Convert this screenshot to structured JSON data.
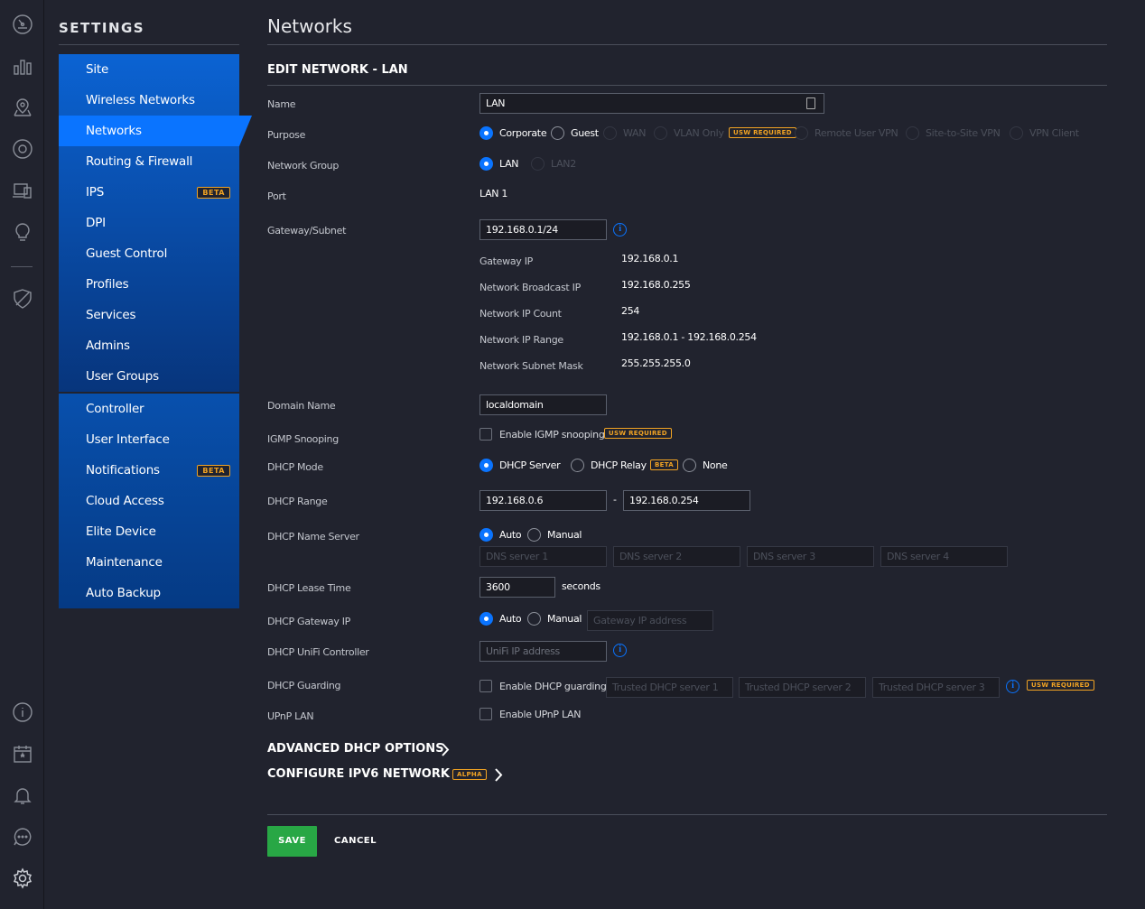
{
  "settings": {
    "title": "SETTINGS",
    "menu_top": [
      {
        "label": "Site"
      },
      {
        "label": "Wireless Networks"
      },
      {
        "label": "Networks"
      },
      {
        "label": "Routing & Firewall"
      },
      {
        "label": "IPS",
        "badge": "BETA"
      },
      {
        "label": "DPI"
      },
      {
        "label": "Guest Control"
      },
      {
        "label": "Profiles"
      },
      {
        "label": "Services"
      },
      {
        "label": "Admins"
      },
      {
        "label": "User Groups"
      }
    ],
    "menu_bottom": [
      {
        "label": "Controller"
      },
      {
        "label": "User Interface"
      },
      {
        "label": "Notifications",
        "badge": "BETA"
      },
      {
        "label": "Cloud Access"
      },
      {
        "label": "Elite Device"
      },
      {
        "label": "Maintenance"
      },
      {
        "label": "Auto Backup"
      }
    ]
  },
  "page": {
    "title": "Networks",
    "section": "EDIT NETWORK - LAN"
  },
  "form": {
    "name": {
      "label": "Name",
      "value": "LAN"
    },
    "purpose": {
      "label": "Purpose",
      "options": [
        "Corporate",
        "Guest",
        "WAN",
        "VLAN Only",
        "Remote User VPN",
        "Site-to-Site VPN",
        "VPN Client"
      ],
      "selected": "Corporate",
      "vlan_tag": "USW REQUIRED"
    },
    "network_group": {
      "label": "Network Group",
      "options": [
        "LAN",
        "LAN2"
      ],
      "selected": "LAN"
    },
    "port": {
      "label": "Port",
      "value": "LAN 1"
    },
    "gateway_subnet": {
      "label": "Gateway/Subnet",
      "value": "192.168.0.1/24"
    },
    "subnet_info": [
      {
        "label": "Gateway IP",
        "value": "192.168.0.1"
      },
      {
        "label": "Network Broadcast IP",
        "value": "192.168.0.255"
      },
      {
        "label": "Network IP Count",
        "value": "254"
      },
      {
        "label": "Network IP Range",
        "value": "192.168.0.1 - 192.168.0.254"
      },
      {
        "label": "Network Subnet Mask",
        "value": "255.255.255.0"
      }
    ],
    "domain_name": {
      "label": "Domain Name",
      "value": "localdomain"
    },
    "igmp": {
      "label": "IGMP Snooping",
      "checkbox": "Enable IGMP snooping",
      "tag": "USW REQUIRED"
    },
    "dhcp_mode": {
      "label": "DHCP Mode",
      "options": [
        "DHCP Server",
        "DHCP Relay",
        "None"
      ],
      "selected": "DHCP Server",
      "relay_tag": "BETA"
    },
    "dhcp_range": {
      "label": "DHCP Range",
      "start": "192.168.0.6",
      "separator": "-",
      "end": "192.168.0.254"
    },
    "dhcp_name_server": {
      "label": "DHCP Name Server",
      "options": [
        "Auto",
        "Manual"
      ],
      "selected": "Auto",
      "placeholders": [
        "DNS server 1",
        "DNS server 2",
        "DNS server 3",
        "DNS server 4"
      ]
    },
    "dhcp_lease": {
      "label": "DHCP Lease Time",
      "value": "3600",
      "unit": "seconds"
    },
    "dhcp_gateway": {
      "label": "DHCP Gateway IP",
      "options": [
        "Auto",
        "Manual"
      ],
      "selected": "Auto",
      "placeholder": "Gateway IP address"
    },
    "dhcp_unifi": {
      "label": "DHCP UniFi Controller",
      "placeholder": "UniFi IP address"
    },
    "dhcp_guarding": {
      "label": "DHCP Guarding",
      "checkbox": "Enable DHCP guarding",
      "placeholders": [
        "Trusted DHCP server 1",
        "Trusted DHCP server 2",
        "Trusted DHCP server 3"
      ],
      "tag": "USW REQUIRED"
    },
    "upnp": {
      "label": "UPnP LAN",
      "checkbox": "Enable UPnP LAN"
    }
  },
  "expanders": {
    "advanced_dhcp": "ADVANCED DHCP OPTIONS",
    "ipv6": "CONFIGURE IPV6 NETWORK",
    "ipv6_tag": "ALPHA"
  },
  "actions": {
    "save": "SAVE",
    "cancel": "CANCEL"
  },
  "colors": {
    "accent": "#0a74ff",
    "save": "#28a745",
    "tag": "#f1a323"
  }
}
